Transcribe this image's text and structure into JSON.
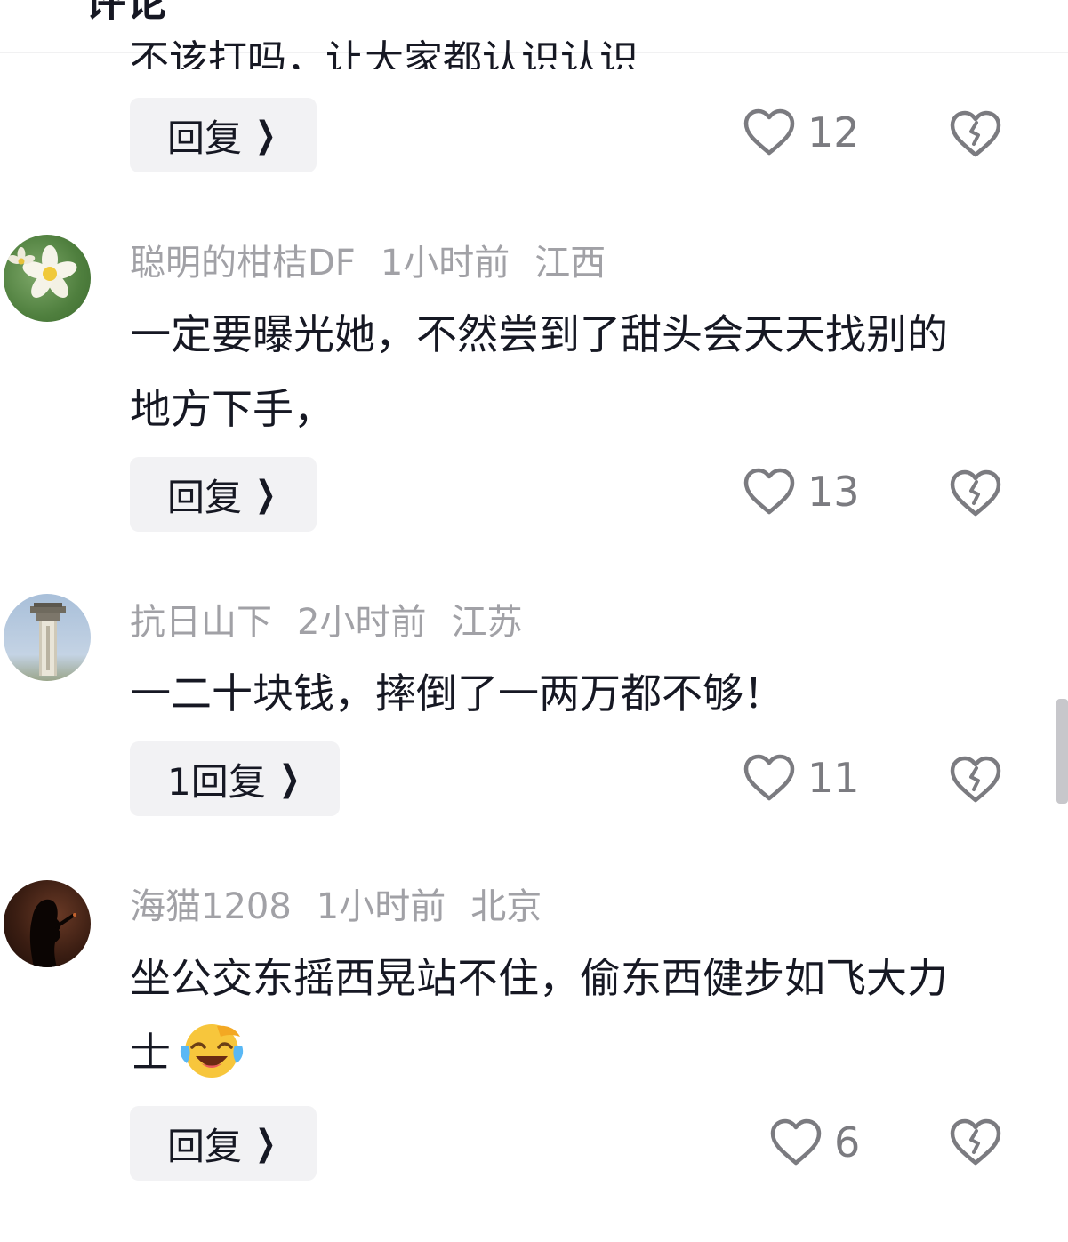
{
  "header": {
    "title_fragment": "评论"
  },
  "partial_comment": {
    "text_fragment": "不该打吗，让大家都认识认识",
    "reply_label": "回复",
    "likes": "12"
  },
  "comments": [
    {
      "user": "聪明的柑桔DF",
      "time": "1小时前",
      "location": "江西",
      "text": "一定要曝光她，不然尝到了甜头会天天找别的地方下手，",
      "reply_label": "回复",
      "likes": "13",
      "avatar": "plumeria-flower-avatar"
    },
    {
      "user": "抗日山下",
      "time": "2小时前",
      "location": "江苏",
      "text": "一二十块钱，摔倒了一两万都不够！",
      "reply_label": "1回复",
      "likes": "11",
      "avatar": "monument-tower-avatar"
    },
    {
      "user": "海猫1208",
      "time": "1小时前",
      "location": "北京",
      "text": "坐公交东摇西晃站不住，偷东西健步如飞大力士",
      "emoji": "laughing-crying-emoji",
      "reply_label": "回复",
      "likes": "6",
      "avatar": "silhouette-woman-avatar"
    }
  ],
  "icons": {
    "like": "heart-outline-icon",
    "dislike": "broken-heart-icon",
    "chevron": "chevron-right-icon"
  },
  "colors": {
    "meta_text": "#a1a1a6",
    "reply_bg": "#f2f2f4",
    "count_text": "#7b7b80"
  }
}
